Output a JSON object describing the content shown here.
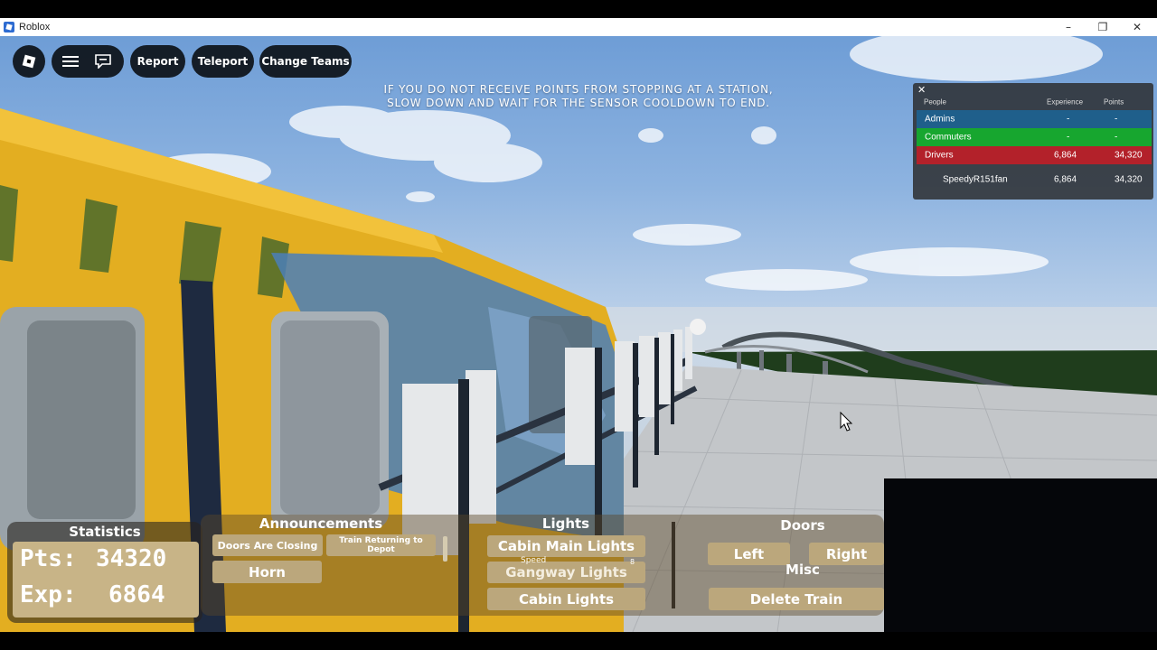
{
  "window": {
    "title": "Roblox",
    "controls": [
      "–",
      "❐",
      "✕"
    ]
  },
  "topbar": {
    "report_label": "Report",
    "teleport_label": "Teleport",
    "change_teams_label": "Change Teams"
  },
  "notice": {
    "line1": "IF YOU DO NOT RECEIVE POINTS FROM STOPPING AT A STATION,",
    "line2": "SLOW DOWN AND WAIT FOR THE SENSOR COOLDOWN TO END."
  },
  "leaderboard": {
    "close": "✕",
    "headers": {
      "people": "People",
      "experience": "Experience",
      "points": "Points"
    },
    "teams": [
      {
        "name": "Admins",
        "experience": "-",
        "points": "-",
        "color": "#1f5f8b"
      },
      {
        "name": "Commuters",
        "experience": "-",
        "points": "-",
        "color": "#17a62f"
      },
      {
        "name": "Drivers",
        "experience": "6,864",
        "points": "34,320",
        "color": "#b3212a"
      }
    ],
    "players": [
      {
        "name": "SpeedyR151fan",
        "experience": "6,864",
        "points": "34,320"
      }
    ]
  },
  "statistics": {
    "title": "Statistics",
    "pts_label": "Pts:",
    "pts_value": "34320",
    "exp_label": "Exp:",
    "exp_value": "6864"
  },
  "announcements": {
    "title": "Announcements",
    "doors_closing": "Doors Are Closing",
    "train_returning": "Train Returning to Depot",
    "horn": "Horn"
  },
  "lights": {
    "title": "Lights",
    "cabin_main": "Cabin Main Lights",
    "gangway": "Gangway Lights",
    "cabin": "Cabin Lights",
    "speed_label": "Speed",
    "speed_value": "8"
  },
  "doors": {
    "title": "Doors",
    "left": "Left",
    "right": "Right"
  },
  "misc": {
    "title": "Misc",
    "delete_train": "Delete Train"
  },
  "colors": {
    "train_yellow": "#e8b320",
    "button_tan": "#bba77c",
    "hud_black": "#0d0d0d"
  }
}
